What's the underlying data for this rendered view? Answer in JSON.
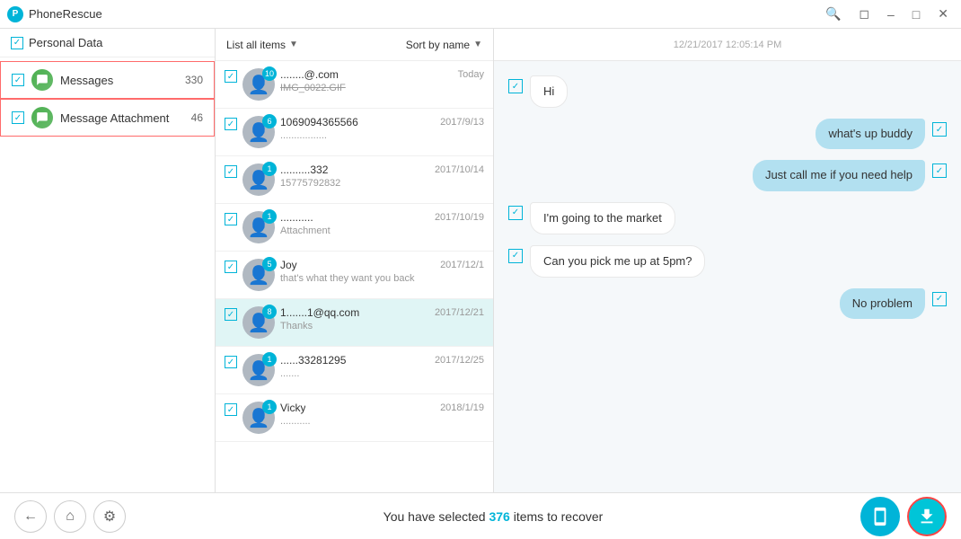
{
  "app": {
    "title": "PhoneRescue",
    "logo": "P"
  },
  "titlebar": {
    "controls": [
      "search",
      "restore",
      "minimize",
      "maximize",
      "close"
    ]
  },
  "sidebar": {
    "header": "Personal Data",
    "items": [
      {
        "id": "messages",
        "label": "Messages",
        "count": "330",
        "checked": true,
        "highlighted": true
      },
      {
        "id": "attachment",
        "label": "Message Attachment",
        "count": "46",
        "checked": true,
        "highlighted": true
      }
    ]
  },
  "toolbar": {
    "list_all_label": "List all items",
    "sort_label": "Sort by name"
  },
  "message_list": [
    {
      "id": 1,
      "badge": "10",
      "name": "........@.com",
      "preview": "IMG_0022.GIF",
      "preview_strikethrough": true,
      "date": "Today",
      "checked": true,
      "selected": false
    },
    {
      "id": 2,
      "badge": "6",
      "name": "1069094365566",
      "preview": ".................",
      "preview_strikethrough": false,
      "date": "2017/9/13",
      "checked": true,
      "selected": false
    },
    {
      "id": 3,
      "badge": "1",
      "name": "..........332",
      "preview": "15775792832",
      "preview_strikethrough": false,
      "date": "2017/10/14",
      "checked": true,
      "selected": false
    },
    {
      "id": 4,
      "badge": "1",
      "name": "...........",
      "preview": "Attachment",
      "preview_strikethrough": false,
      "date": "2017/10/19",
      "checked": true,
      "selected": false
    },
    {
      "id": 5,
      "badge": "5",
      "name": "Joy",
      "preview": "that's what they want you back",
      "preview_strikethrough": false,
      "date": "2017/12/1",
      "checked": true,
      "selected": false
    },
    {
      "id": 6,
      "badge": "8",
      "name": "1.......1@qq.com",
      "preview": "Thanks",
      "preview_strikethrough": false,
      "date": "2017/12/21",
      "checked": true,
      "selected": true
    },
    {
      "id": 7,
      "badge": "1",
      "name": "......33281295",
      "preview": ".......",
      "preview_strikethrough": false,
      "date": "2017/12/25",
      "checked": true,
      "selected": false
    },
    {
      "id": 8,
      "badge": "1",
      "name": "Vicky",
      "preview": "...........",
      "preview_strikethrough": false,
      "date": "2018/1/19",
      "checked": true,
      "selected": false
    }
  ],
  "chat": {
    "timestamp": "12/21/2017 12:05:14 PM",
    "messages": [
      {
        "id": 1,
        "type": "received",
        "text": "Hi",
        "checked": true
      },
      {
        "id": 2,
        "type": "sent",
        "text": "what's up buddy",
        "checked": true
      },
      {
        "id": 3,
        "type": "sent",
        "text": "Just call me if you need help",
        "checked": true
      },
      {
        "id": 4,
        "type": "received",
        "text": "I'm going to the market",
        "checked": true
      },
      {
        "id": 5,
        "type": "received",
        "text": "Can you pick me up at 5pm?",
        "checked": true
      },
      {
        "id": 6,
        "type": "sent",
        "text": "No problem",
        "checked": true
      }
    ]
  },
  "bottom": {
    "status_text": "You have selected",
    "count": "376",
    "items_label": "items to recover"
  }
}
